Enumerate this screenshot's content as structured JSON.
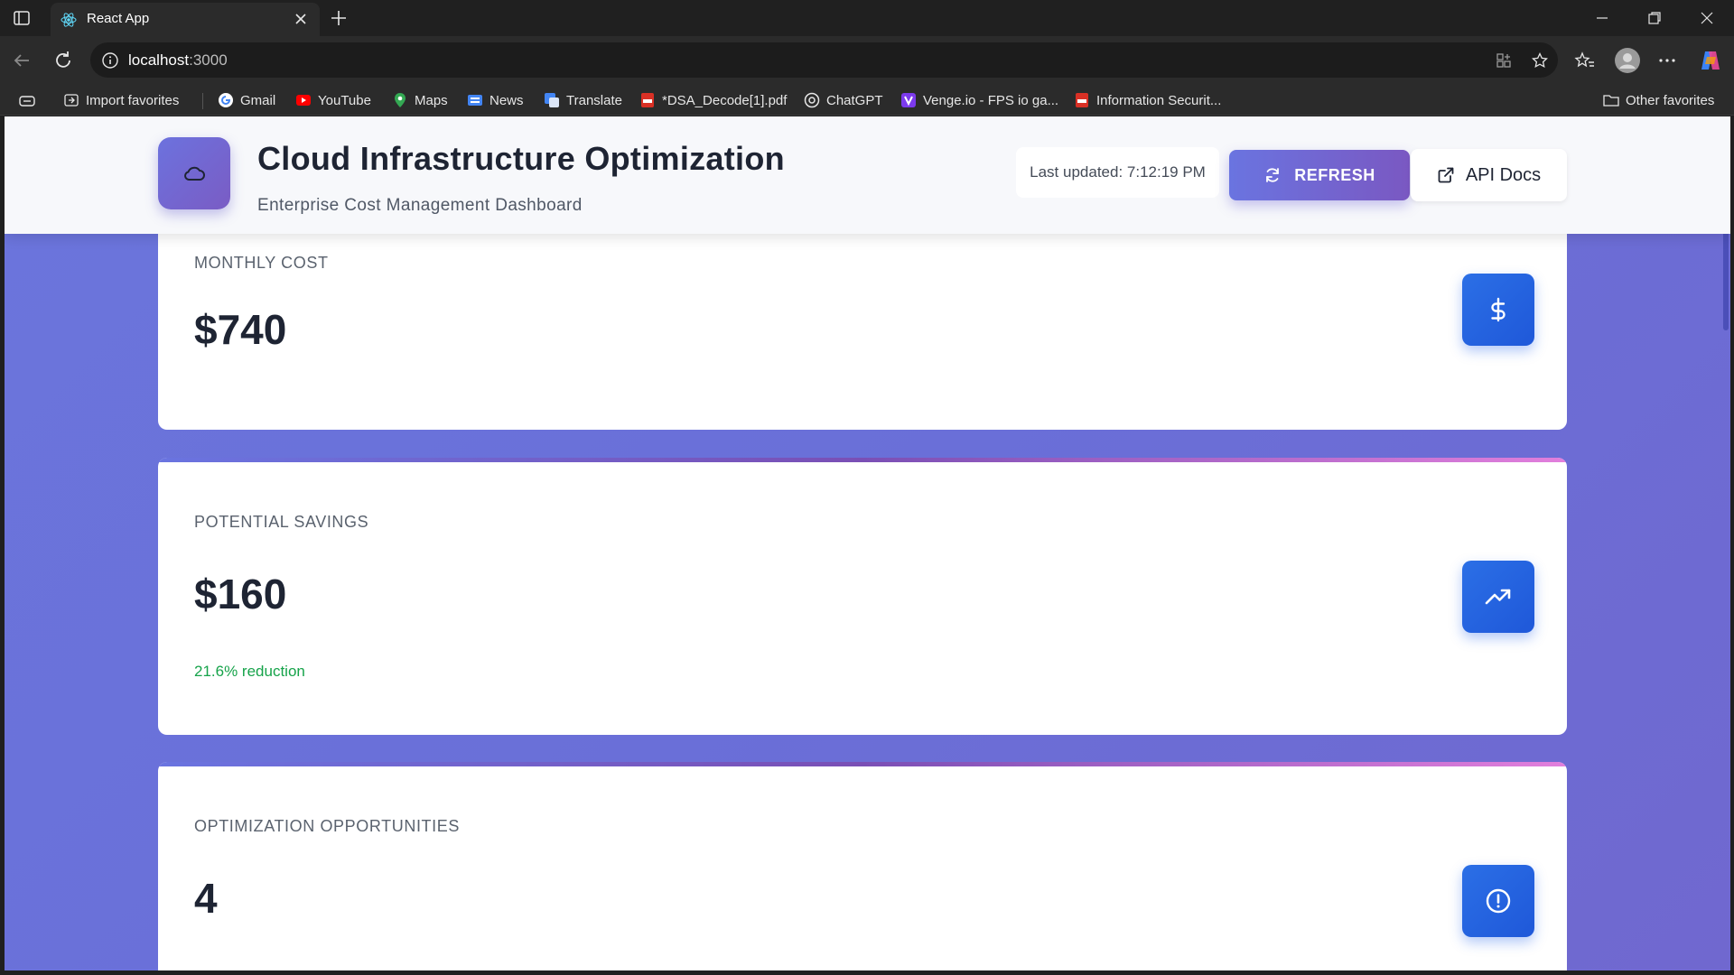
{
  "browser": {
    "tab_title": "React App",
    "url_host": "localhost",
    "url_port": ":3000",
    "favorites": [
      {
        "label": "Import favorites",
        "icon": "import-icon"
      },
      {
        "label": "Gmail",
        "icon": "google-icon"
      },
      {
        "label": "YouTube",
        "icon": "youtube-icon"
      },
      {
        "label": "Maps",
        "icon": "maps-pin-icon"
      },
      {
        "label": "News",
        "icon": "news-icon"
      },
      {
        "label": "Translate",
        "icon": "translate-icon"
      },
      {
        "label": "*DSA_Decode[1].pdf",
        "icon": "pdf-icon"
      },
      {
        "label": "ChatGPT",
        "icon": "chatgpt-icon"
      },
      {
        "label": "Venge.io - FPS io ga...",
        "icon": "venge-icon"
      },
      {
        "label": "Information Securit...",
        "icon": "pdf-icon"
      }
    ],
    "other_favorites": "Other favorites"
  },
  "header": {
    "title": "Cloud Infrastructure Optimization",
    "subtitle": "Enterprise Cost Management Dashboard",
    "last_updated": "Last updated: 7:12:19 PM",
    "refresh_label": "REFRESH",
    "api_docs_label": "API Docs"
  },
  "cards": [
    {
      "label": "MONTHLY COST",
      "value": "$740",
      "note": "",
      "icon": "dollar-icon"
    },
    {
      "label": "POTENTIAL SAVINGS",
      "value": "$160",
      "note": "21.6% reduction",
      "icon": "trending-up-icon"
    },
    {
      "label": "OPTIMIZATION OPPORTUNITIES",
      "value": "4",
      "note": "",
      "icon": "alert-circle-icon"
    }
  ],
  "colors": {
    "accent_gradient_start": "#6a74e0",
    "accent_gradient_end": "#7a58c2",
    "card_icon_blue": "#2563eb",
    "savings_green": "#16a34a",
    "page_background": "#6b71db"
  }
}
